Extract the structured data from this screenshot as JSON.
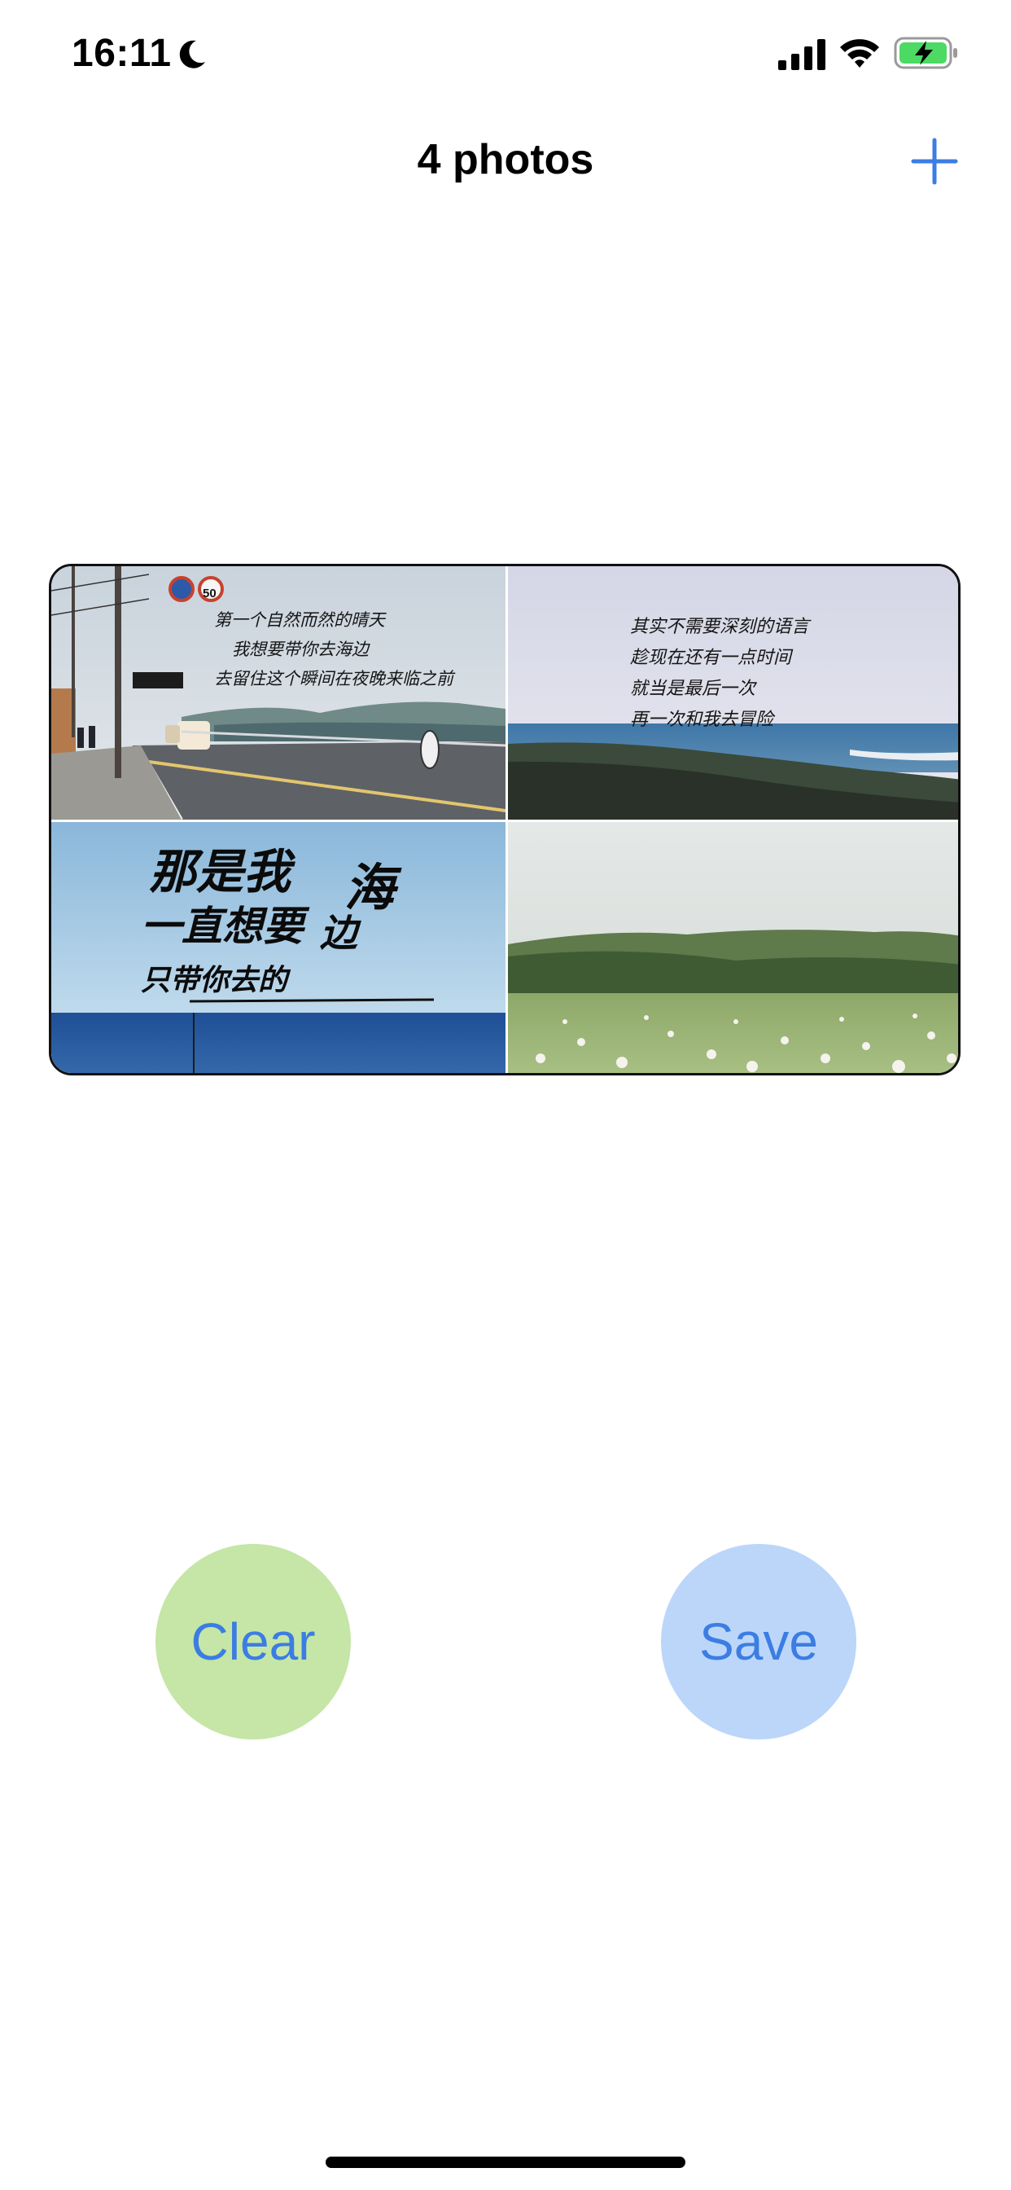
{
  "status_bar": {
    "time": "16:11",
    "icons": [
      "moon-icon",
      "signal-icon",
      "wifi-icon",
      "battery-charging-icon"
    ]
  },
  "nav": {
    "title": "4 photos",
    "add_icon": "plus-icon"
  },
  "colors": {
    "accent": "#3b7de3",
    "clear_bg": "#c5e6a6",
    "save_bg": "#bcd6f9"
  },
  "collage": {
    "photos": [
      {
        "scene": "seaside-road",
        "sign_text": "50",
        "caption_lines": [
          "第一个自然而然的晴天",
          "我想要带你去海边",
          "去留住这个瞬间在夜晚来临之前"
        ]
      },
      {
        "scene": "rocky-coast",
        "caption_lines": [
          "其实不需要深刻的语言",
          "趁现在还有一点时间",
          "就当是最后一次",
          "再一次和我去冒险"
        ]
      },
      {
        "scene": "ocean-horizon",
        "caption_lines": [
          "那是我",
          "海",
          "一直想要",
          "边",
          "只带你去的"
        ]
      },
      {
        "scene": "flower-meadow",
        "caption_lines": []
      }
    ]
  },
  "actions": {
    "clear_label": "Clear",
    "save_label": "Save"
  }
}
